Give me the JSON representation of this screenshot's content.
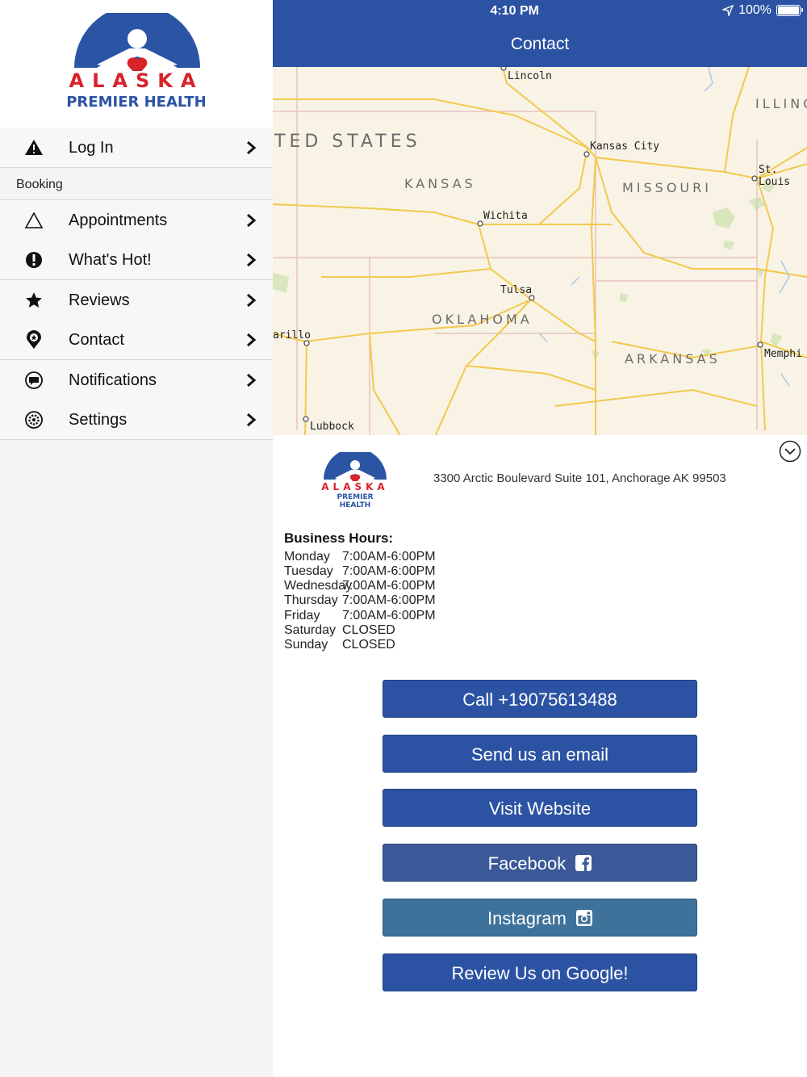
{
  "sidebar": {
    "logo": {
      "line1": "ALASKA",
      "line2": "PREMIER HEALTH"
    },
    "login": {
      "label": "Log In",
      "icon": "warning-icon"
    },
    "section_header": "Booking",
    "items": [
      {
        "label": "Appointments",
        "icon": "triangle-outline-icon"
      },
      {
        "label": "What's Hot!",
        "icon": "exclamation-circle-icon"
      },
      {
        "label": "Reviews",
        "icon": "star-icon"
      },
      {
        "label": "Contact",
        "icon": "map-pin-icon"
      },
      {
        "label": "Notifications",
        "icon": "chat-bubble-icon"
      },
      {
        "label": "Settings",
        "icon": "gear-icon"
      }
    ]
  },
  "status_bar": {
    "time": "4:10 PM",
    "battery": "100%"
  },
  "header": {
    "title": "Contact"
  },
  "map": {
    "country_label": "TED STATES",
    "states": [
      "KANSAS",
      "MISSOURI",
      "OKLAHOMA",
      "ARKANSAS",
      "ILLINO"
    ],
    "cities": [
      "Lincoln",
      "Kansas City",
      "St. Louis",
      "Wichita",
      "Tulsa",
      "arillo",
      "Memphi",
      "Lubbock"
    ]
  },
  "contact": {
    "logo": {
      "line1": "ALASKA",
      "line2": "PREMIER HEALTH"
    },
    "address": "3300 Arctic Boulevard Suite 101, Anchorage AK 99503",
    "hours_title": "Business Hours:",
    "hours": [
      {
        "day": "Monday",
        "time": "7:00AM-6:00PM"
      },
      {
        "day": "Tuesday",
        "time": "7:00AM-6:00PM"
      },
      {
        "day": "Wednesday",
        "time": "7:00AM-6:00PM"
      },
      {
        "day": "Thursday",
        "time": "7:00AM-6:00PM"
      },
      {
        "day": "Friday",
        "time": "7:00AM-6:00PM"
      },
      {
        "day": "Saturday",
        "time": "CLOSED"
      },
      {
        "day": "Sunday",
        "time": "CLOSED"
      }
    ]
  },
  "buttons": {
    "call": "Call +19075613488",
    "email": "Send us an email",
    "website": "Visit Website",
    "facebook": "Facebook",
    "instagram": "Instagram",
    "google": "Review Us on Google!"
  },
  "colors": {
    "brand_blue": "#2c53a3",
    "brand_red": "#d8232a",
    "facebook": "#3b5998",
    "instagram": "#3f729b"
  }
}
